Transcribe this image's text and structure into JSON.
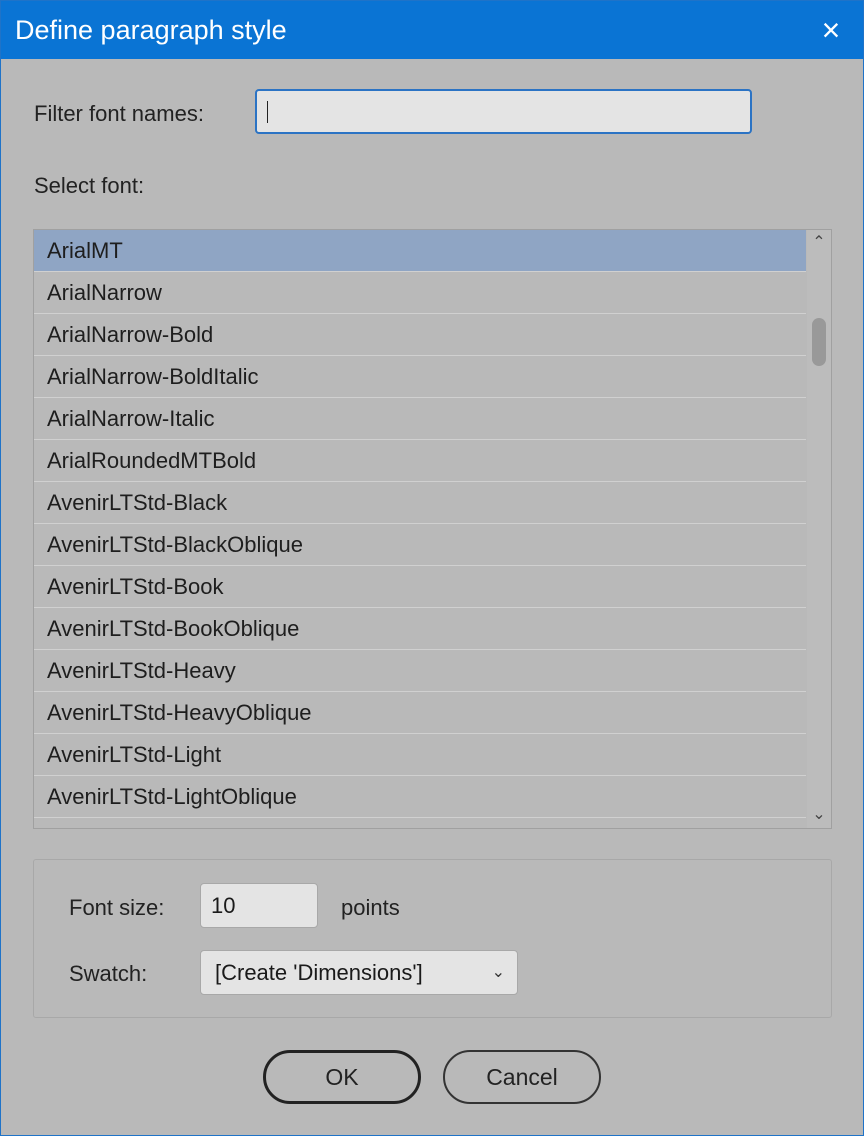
{
  "window": {
    "title": "Define paragraph style",
    "close_icon": "×"
  },
  "filter": {
    "label": "Filter font names:",
    "value": ""
  },
  "select_font_label": "Select font:",
  "fonts": [
    "ArialMT",
    "ArialNarrow",
    "ArialNarrow-Bold",
    "ArialNarrow-BoldItalic",
    "ArialNarrow-Italic",
    "ArialRoundedMTBold",
    "AvenirLTStd-Black",
    "AvenirLTStd-BlackOblique",
    "AvenirLTStd-Book",
    "AvenirLTStd-BookOblique",
    "AvenirLTStd-Heavy",
    "AvenirLTStd-HeavyOblique",
    "AvenirLTStd-Light",
    "AvenirLTStd-LightOblique"
  ],
  "selected_font": "ArialMT",
  "font_size": {
    "label": "Font size:",
    "value": "10",
    "unit": "points"
  },
  "swatch": {
    "label": "Swatch:",
    "value": "[Create 'Dimensions']"
  },
  "buttons": {
    "ok": "OK",
    "cancel": "Cancel"
  },
  "colors": {
    "title_bar": "#0a74d4",
    "selection": "#8fa5c4",
    "background": "#b9b9b9"
  }
}
